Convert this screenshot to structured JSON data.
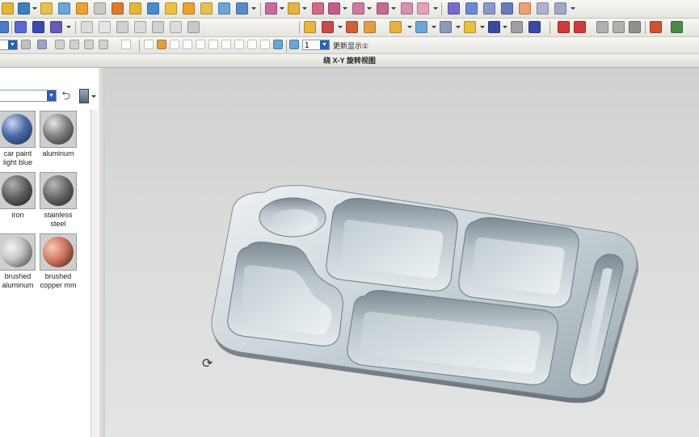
{
  "toolbar": {
    "fit_value": "1",
    "update_display_label": "更新显示①"
  },
  "view_title": "绕 X-Y 旋转视图",
  "material_panel": {
    "dropdown_value": "",
    "materials": [
      {
        "label_line1": "car paint",
        "label_line2": "light blue"
      },
      {
        "label_line1": "aluminum",
        "label_line2": ""
      },
      {
        "label_line1": "iron",
        "label_line2": ""
      },
      {
        "label_line1": "stainless",
        "label_line2": "steel"
      },
      {
        "label_line1": "brushed",
        "label_line2": "aluminum"
      },
      {
        "label_line1": "brushed",
        "label_line2": "copper mm"
      }
    ]
  },
  "colors": {
    "viewport_bg": "#d6d7d7",
    "tray_metal": "#c9d3d8",
    "toolbar_bg": "#ecebe7"
  }
}
